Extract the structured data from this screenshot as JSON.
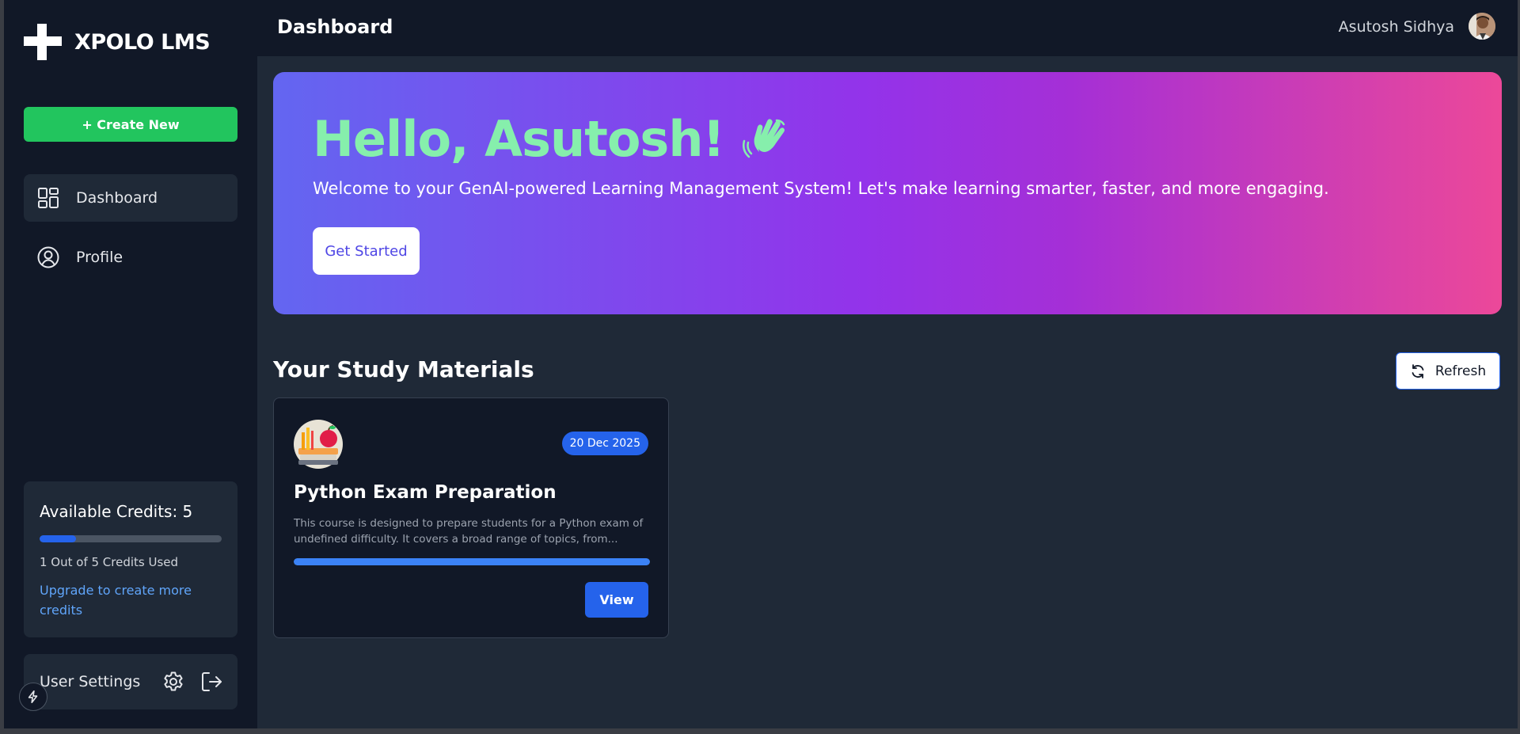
{
  "sidebar": {
    "brand": "XPOLO LMS",
    "create_label": "+ Create New",
    "nav": [
      {
        "label": "Dashboard",
        "icon": "dashboard-grid-icon",
        "active": true
      },
      {
        "label": "Profile",
        "icon": "user-circle-icon",
        "active": false
      }
    ],
    "credits": {
      "title": "Available Credits: 5",
      "used": 1,
      "total": 5,
      "used_text": "1 Out of 5 Credits Used",
      "upgrade_text": "Upgrade to create more credits"
    },
    "settings_label": "User Settings"
  },
  "header": {
    "title": "Dashboard",
    "user_name": "Asutosh Sidhya"
  },
  "hero": {
    "greeting": "Hello, Asutosh!",
    "emoji": "👋",
    "subtitle": "Welcome to your GenAI-powered Learning Management System! Let's make learning smarter, faster, and more engaging.",
    "cta_label": "Get Started"
  },
  "study": {
    "section_title": "Your Study Materials",
    "refresh_label": "Refresh",
    "cards": [
      {
        "date": "20 Dec 2025",
        "title": "Python Exam Preparation",
        "description": "This course is designed to prepare students for a Python exam of undefined difficulty. It covers a broad range of topics, from...",
        "progress": 1.0,
        "view_label": "View"
      }
    ]
  },
  "colors": {
    "accent_green": "#22c55e",
    "accent_blue": "#2563eb",
    "hero_greeting": "#86efac",
    "hero_gradient_start": "#6366f1",
    "hero_gradient_mid": "#9333ea",
    "hero_gradient_end": "#ec4899"
  }
}
